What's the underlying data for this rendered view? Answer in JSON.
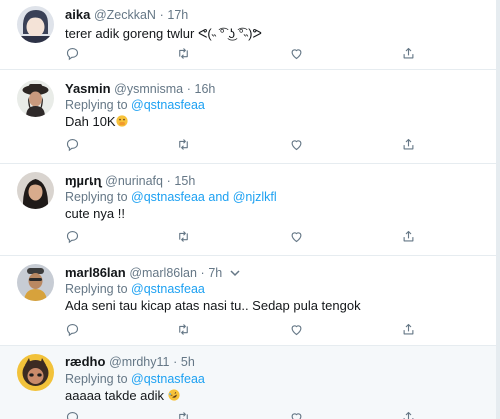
{
  "colors": {
    "text": "#14171a",
    "muted": "#657786",
    "link": "#1da1f2",
    "border": "#e6ecf0",
    "highlight_bg": "#f5f8fa"
  },
  "tweets": [
    {
      "name": "aika",
      "handle": "@ZeckkaN",
      "dot": "·",
      "time": "17h",
      "reply_prefix": "",
      "mentions": [],
      "text": "terer adik goreng twlur ᕙ(˵ ͡° ͜ʖ ͡°˵)ᕗ"
    },
    {
      "name": "Yasmin",
      "handle": "@ysmnisma",
      "dot": "·",
      "time": "16h",
      "reply_prefix": "Replying to",
      "mentions": [
        "@qstnasfeaa"
      ],
      "text": "Dah 10K"
    },
    {
      "name": "ɱµɾเɳ",
      "handle": "@nurinafq",
      "dot": "·",
      "time": "15h",
      "reply_prefix": "Replying to",
      "mentions": [
        "@qstnasfeaa",
        "@njzlkfl"
      ],
      "mention_joiner": "and",
      "text": "cute nya !!"
    },
    {
      "name": "marl86lan",
      "handle": "@marl86lan",
      "dot": "·",
      "time": "7h",
      "reply_prefix": "Replying to",
      "mentions": [
        "@qstnasfeaa"
      ],
      "text": "Ada seni tau kicap atas nasi tu.. Sedap pula tengok"
    },
    {
      "name": "rædho",
      "handle": "@mrdhy11",
      "dot": "·",
      "time": "5h",
      "reply_prefix": "Replying to",
      "mentions": [
        "@qstnasfeaa"
      ],
      "text": "aaaaa takde adik"
    }
  ],
  "icons": {
    "reply": "reply-icon",
    "retweet": "retweet-icon",
    "like": "heart-icon",
    "share": "share-icon",
    "emoji_tweet2": "face-with-hand-over-mouth-emoji",
    "emoji_tweet5": "rolling-on-the-floor-laughing-emoji"
  }
}
